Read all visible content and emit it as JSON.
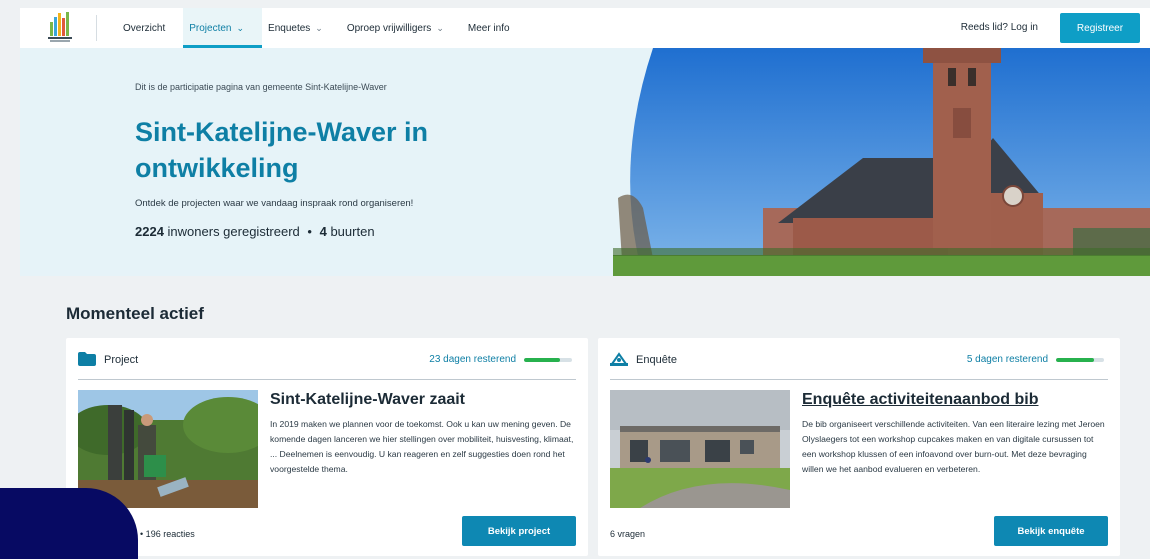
{
  "header": {
    "nav": [
      {
        "label": "Overzicht",
        "dropdown": false,
        "active": false
      },
      {
        "label": "Projecten",
        "dropdown": true,
        "active": true
      },
      {
        "label": "Enquetes",
        "dropdown": true,
        "active": false
      },
      {
        "label": "Oproep vrijwilligers",
        "dropdown": true,
        "active": false
      },
      {
        "label": "Meer info",
        "dropdown": false,
        "active": false
      }
    ],
    "login_label": "Reeds lid? Log in",
    "register_label": "Registreer"
  },
  "hero": {
    "intro": "Dit is de participatie pagina van gemeente Sint-Katelijne-Waver",
    "title": "Sint-Katelijne-Waver in ontwikkeling",
    "subtitle": "Ontdek de projecten waar we vandaag inspraak rond organiseren!",
    "stats": {
      "residents": "2224",
      "residents_label": "inwoners geregistreerd",
      "separator": "•",
      "neighborhoods": "4",
      "neighborhoods_label": "buurten"
    }
  },
  "section_title": "Momenteel actief",
  "cards": [
    {
      "type": "Project",
      "type_icon": "folder-icon",
      "days_left": "23 dagen resterend",
      "progress": 0.75,
      "title": "Sint-Katelijne-Waver zaait",
      "description": "In 2019 maken we plannen voor de toekomst. Ook u kan uw mening geven. De komende dagen lanceren we hier stellingen over mobiliteit, huisvesting, klimaat, ... Deelnemen is eenvoudig. U kan reageren en zelf suggesties doen rond het voorgestelde thema.",
      "footer": "2244 stemmen • 196 reacties",
      "button": "Bekijk project"
    },
    {
      "type": "Enquête",
      "type_icon": "survey-icon",
      "days_left": "5 dagen resterend",
      "progress": 0.8,
      "title": "Enquête activiteitenaanbod bib",
      "description": "De bib organiseert verschillende activiteiten. Van een literaire lezing met Jeroen Olyslaegers tot een workshop cupcakes maken en van digitale cursussen tot een workshop klussen of een infoavond over burn-out. Met deze bevraging willen we het aanbod evalueren en verbeteren.",
      "footer": "6 vragen",
      "button": "Bekijk enquête"
    }
  ],
  "colors": {
    "brand": "#0e9ec6",
    "title": "#0e7fa5",
    "progress": "#27b14e",
    "corner": "#070a63"
  }
}
